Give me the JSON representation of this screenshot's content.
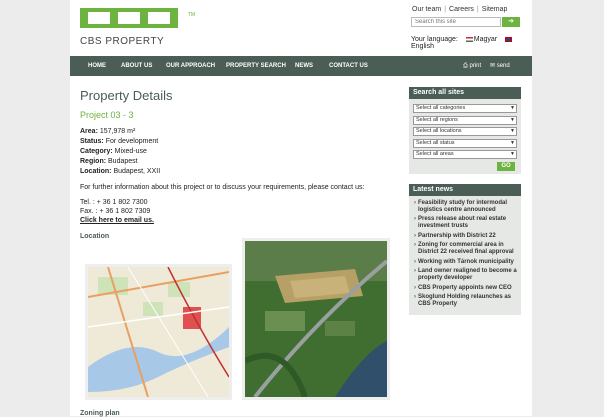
{
  "header": {
    "logo_mark": "cbs",
    "logo_tm": "TM",
    "logo_text": "CBS PROPERTY",
    "toplinks": [
      "Our team",
      "Careers",
      "Sitemap"
    ],
    "search_placeholder": "Search this site",
    "search_button": "➜",
    "language_label": "Your language:",
    "languages": [
      "Magyar",
      "English"
    ]
  },
  "nav": {
    "items": [
      "HOME",
      "ABOUT US",
      "OUR APPROACH",
      "PROPERTY SEARCH",
      "NEWS",
      "CONTACT US"
    ],
    "print": "print",
    "send": "send"
  },
  "main": {
    "title": "Property Details",
    "subtitle": "Project 03 - 3",
    "details": [
      {
        "label": "Area:",
        "value": "157,978 m²"
      },
      {
        "label": "Status:",
        "value": "For development"
      },
      {
        "label": "Category:",
        "value": "Mixed-use"
      },
      {
        "label": "Region:",
        "value": "Budapest"
      },
      {
        "label": "Location:",
        "value": "Budapest, XXII"
      }
    ],
    "paragraph": "For further information about this project or to discuss your requirements, please contact us:",
    "tel": "Tel. : + 36 1 802 7300",
    "fax": "Fax. : + 36 1 802 7309",
    "email_link": "Click here to email us.",
    "location_heading": "Location",
    "zoning_heading": "Zoning plan"
  },
  "sidebar": {
    "search_title": "Search all sites",
    "selects": [
      "Select all categories",
      "Select all regions",
      "Select all locations",
      "Select all status",
      "Select all areas"
    ],
    "go_label": "GO",
    "news_title": "Latest news",
    "news": [
      "Feasibility study for intermodal logistics centre announced",
      "Press release about real estate investment trusts",
      "Partnership with District 22",
      "Zoning for commercial area in District 22 received final approval",
      "Working with Tárnok municipality",
      "Land owner realigned to become a property developer",
      "CBS Property appoints new CEO",
      "Skoglund Holding relaunches as CBS Property"
    ]
  },
  "colors": {
    "brand_green": "#6cb33f",
    "nav_dark": "#4a5e55"
  }
}
